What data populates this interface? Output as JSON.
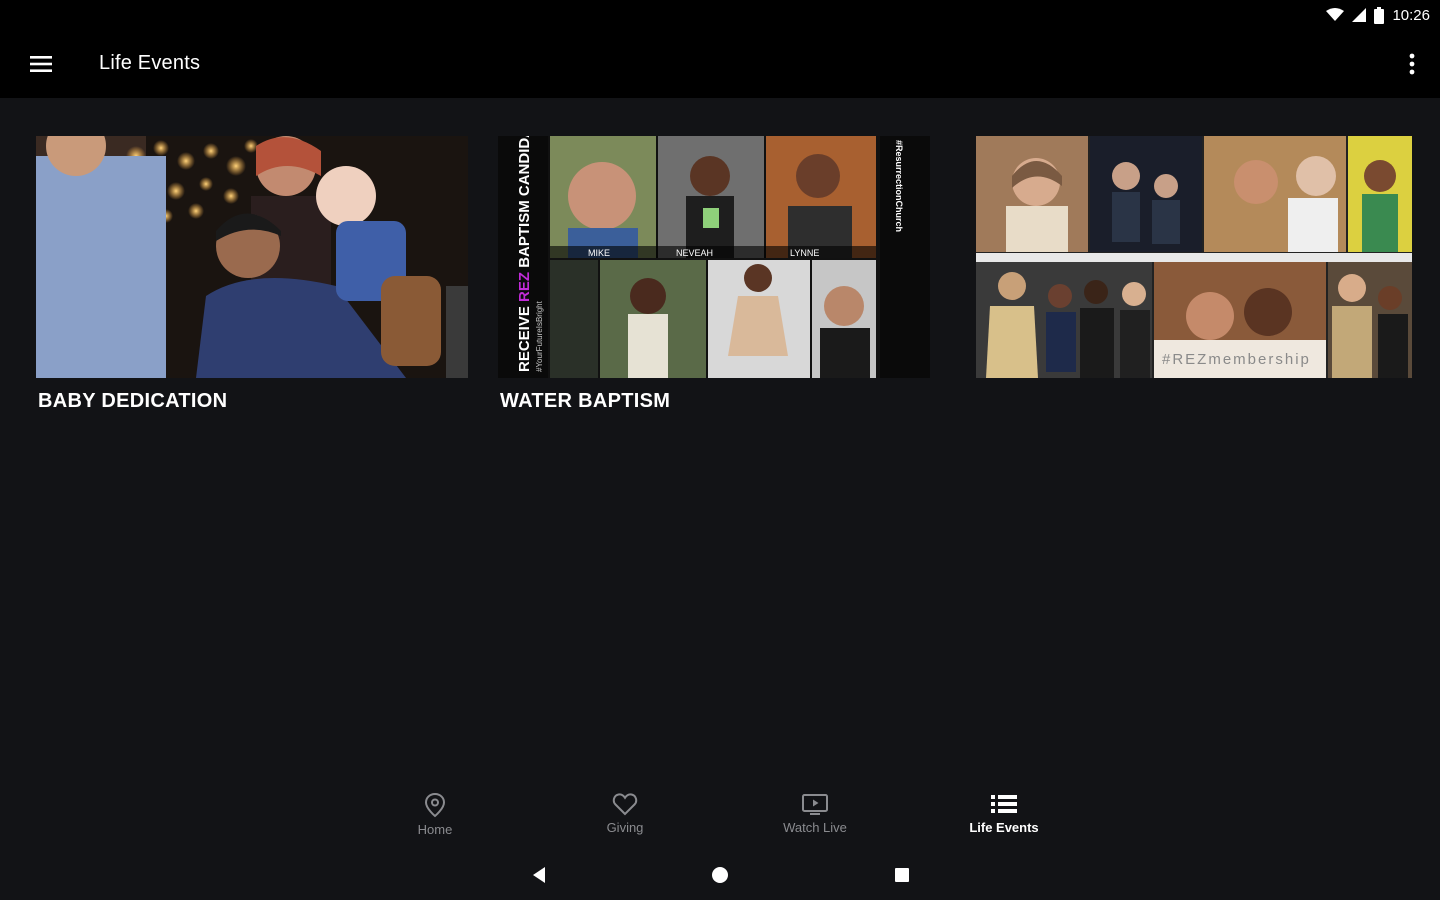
{
  "status_bar": {
    "time": "10:26",
    "icons": [
      "wifi-icon",
      "cell-signal-icon",
      "battery-icon"
    ]
  },
  "app_bar": {
    "title": "Life Events",
    "menu_icon": "hamburger-menu-icon",
    "overflow_icon": "more-vert-icon"
  },
  "cards": [
    {
      "label": "BABY DEDICATION"
    },
    {
      "label": "WATER BAPTISM",
      "image_text": {
        "side_title_a": "RECEIVE ",
        "side_title_b": "REZ",
        "side_title_c": " BAPTISM CANDIDATES",
        "side_hashtag": "#YourFutureIsBright",
        "right_hashtag": "#ResurrectionChurch",
        "names": [
          "MIKE",
          "NEVEAH",
          "LYNNE"
        ]
      }
    },
    {
      "label": "",
      "image_text": {
        "hashtag": "#REZmembership"
      }
    }
  ],
  "bottom_nav": [
    {
      "label": "Home",
      "icon": "location-pin-icon",
      "active": false
    },
    {
      "label": "Giving",
      "icon": "heart-icon",
      "active": false
    },
    {
      "label": "Watch Live",
      "icon": "tv-play-icon",
      "active": false
    },
    {
      "label": "Life Events",
      "icon": "list-icon",
      "active": true
    }
  ],
  "colors": {
    "background": "#121316",
    "bar": "#000000",
    "accent": "#c02bd6",
    "inactive": "#8a8b8f"
  }
}
